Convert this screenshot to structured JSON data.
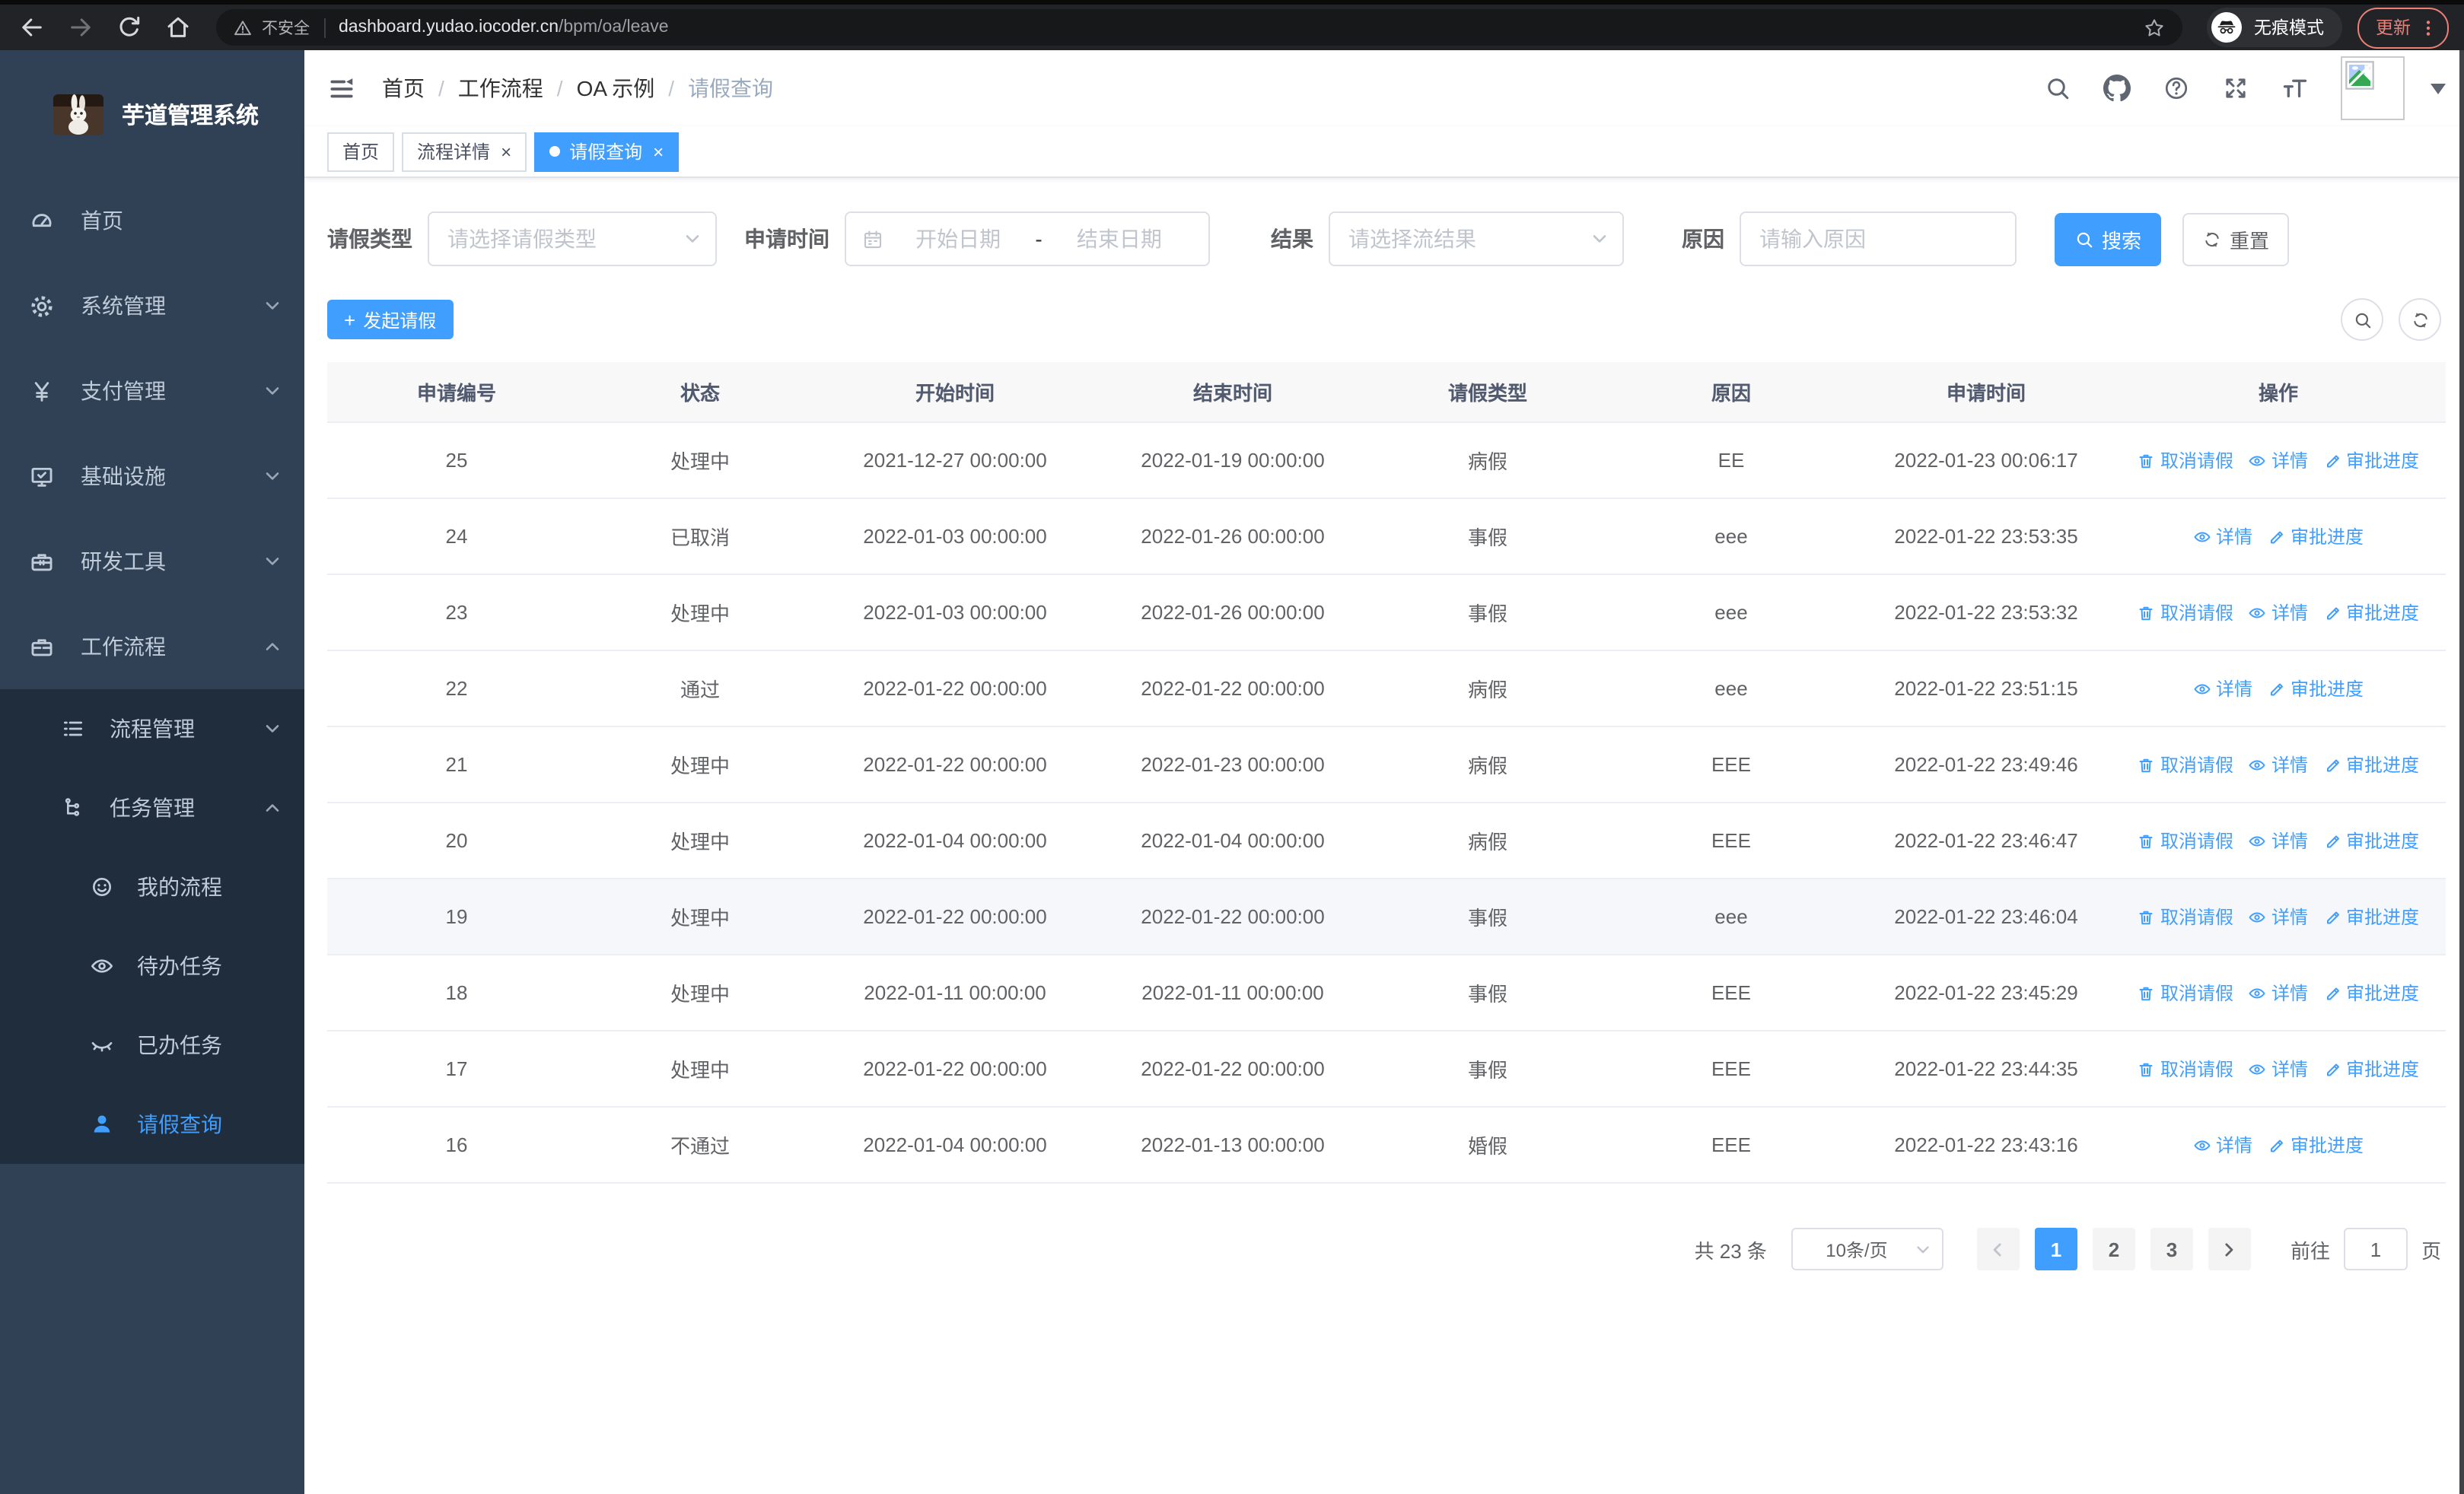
{
  "colors": {
    "primary": "#409eff",
    "sidebar_bg": "#304156",
    "sidebar_submenu_bg": "#1f2d3d",
    "table_header_bg": "#f8f8f9",
    "row_hover_bg": "#f5f7fa",
    "update_accent": "#ec8077"
  },
  "browser": {
    "security_label": "不安全",
    "url_host": "dashboard.yudao.iocoder.cn",
    "url_path": "/bpm/oa/leave",
    "incognito_label": "无痕模式",
    "update_label": "更新"
  },
  "sidebar": {
    "title": "芋道管理系统",
    "items": [
      {
        "key": "home",
        "icon": "gauge-icon",
        "label": "首页",
        "level": 1,
        "chevron": null,
        "active": false
      },
      {
        "key": "system-mgmt",
        "icon": "gear-icon",
        "label": "系统管理",
        "level": 1,
        "chevron": "down",
        "active": false
      },
      {
        "key": "payment-mgmt",
        "icon": "yen-icon",
        "label": "支付管理",
        "level": 1,
        "chevron": "down",
        "active": false
      },
      {
        "key": "infrastructure",
        "icon": "monitor-icon",
        "label": "基础设施",
        "level": 1,
        "chevron": "down",
        "active": false
      },
      {
        "key": "dev-tools",
        "icon": "toolbox-icon",
        "label": "研发工具",
        "level": 1,
        "chevron": "down",
        "active": false
      },
      {
        "key": "workflow",
        "icon": "briefcase-icon",
        "label": "工作流程",
        "level": 1,
        "chevron": "up",
        "active": false
      },
      {
        "key": "process-mgmt",
        "icon": "list-icon",
        "label": "流程管理",
        "level": 2,
        "chevron": "down",
        "active": false
      },
      {
        "key": "task-mgmt",
        "icon": "flow-icon",
        "label": "任务管理",
        "level": 2,
        "chevron": "up",
        "active": false
      },
      {
        "key": "my-process",
        "icon": "face-icon",
        "label": "我的流程",
        "level": 3,
        "chevron": null,
        "active": false
      },
      {
        "key": "todo-tasks",
        "icon": "eye-icon",
        "label": "待办任务",
        "level": 3,
        "chevron": null,
        "active": false
      },
      {
        "key": "done-tasks",
        "icon": "eye-closed-icon",
        "label": "已办任务",
        "level": 3,
        "chevron": null,
        "active": false
      },
      {
        "key": "leave-query",
        "icon": "user-icon",
        "label": "请假查询",
        "level": 3,
        "chevron": null,
        "active": true
      }
    ]
  },
  "header": {
    "breadcrumbs": [
      "首页",
      "工作流程",
      "OA 示例",
      "请假查询"
    ],
    "separator": "/"
  },
  "tabs": [
    {
      "key": "home",
      "label": "首页",
      "closable": false,
      "active": false
    },
    {
      "key": "process-detail",
      "label": "流程详情",
      "closable": true,
      "active": false
    },
    {
      "key": "leave-query",
      "label": "请假查询",
      "closable": true,
      "active": true
    }
  ],
  "filters": {
    "leave_type_label": "请假类型",
    "leave_type_placeholder": "请选择请假类型",
    "apply_time_label": "申请时间",
    "start_date_placeholder": "开始日期",
    "range_separator": "-",
    "end_date_placeholder": "结束日期",
    "result_label": "结果",
    "result_placeholder": "请选择流结果",
    "reason_label": "原因",
    "reason_placeholder": "请输入原因",
    "search_label": "搜索",
    "reset_label": "重置"
  },
  "toolbar": {
    "create_label": "发起请假"
  },
  "table": {
    "columns": [
      "申请编号",
      "状态",
      "开始时间",
      "结束时间",
      "请假类型",
      "原因",
      "申请时间",
      "操作"
    ],
    "action_labels": {
      "cancel": "取消请假",
      "detail": "详情",
      "progress": "审批进度"
    },
    "rows": [
      {
        "id": "25",
        "status": "处理中",
        "start": "2021-12-27 00:00:00",
        "end": "2022-01-19 00:00:00",
        "type": "病假",
        "reason": "EE",
        "apply": "2022-01-23 00:06:17",
        "actions": [
          "cancel",
          "detail",
          "progress"
        ],
        "hover": false
      },
      {
        "id": "24",
        "status": "已取消",
        "start": "2022-01-03 00:00:00",
        "end": "2022-01-26 00:00:00",
        "type": "事假",
        "reason": "eee",
        "apply": "2022-01-22 23:53:35",
        "actions": [
          "detail",
          "progress"
        ],
        "hover": false
      },
      {
        "id": "23",
        "status": "处理中",
        "start": "2022-01-03 00:00:00",
        "end": "2022-01-26 00:00:00",
        "type": "事假",
        "reason": "eee",
        "apply": "2022-01-22 23:53:32",
        "actions": [
          "cancel",
          "detail",
          "progress"
        ],
        "hover": false
      },
      {
        "id": "22",
        "status": "通过",
        "start": "2022-01-22 00:00:00",
        "end": "2022-01-22 00:00:00",
        "type": "病假",
        "reason": "eee",
        "apply": "2022-01-22 23:51:15",
        "actions": [
          "detail",
          "progress"
        ],
        "hover": false
      },
      {
        "id": "21",
        "status": "处理中",
        "start": "2022-01-22 00:00:00",
        "end": "2022-01-23 00:00:00",
        "type": "病假",
        "reason": "EEE",
        "apply": "2022-01-22 23:49:46",
        "actions": [
          "cancel",
          "detail",
          "progress"
        ],
        "hover": false
      },
      {
        "id": "20",
        "status": "处理中",
        "start": "2022-01-04 00:00:00",
        "end": "2022-01-04 00:00:00",
        "type": "病假",
        "reason": "EEE",
        "apply": "2022-01-22 23:46:47",
        "actions": [
          "cancel",
          "detail",
          "progress"
        ],
        "hover": false
      },
      {
        "id": "19",
        "status": "处理中",
        "start": "2022-01-22 00:00:00",
        "end": "2022-01-22 00:00:00",
        "type": "事假",
        "reason": "eee",
        "apply": "2022-01-22 23:46:04",
        "actions": [
          "cancel",
          "detail",
          "progress"
        ],
        "hover": true
      },
      {
        "id": "18",
        "status": "处理中",
        "start": "2022-01-11 00:00:00",
        "end": "2022-01-11 00:00:00",
        "type": "事假",
        "reason": "EEE",
        "apply": "2022-01-22 23:45:29",
        "actions": [
          "cancel",
          "detail",
          "progress"
        ],
        "hover": false
      },
      {
        "id": "17",
        "status": "处理中",
        "start": "2022-01-22 00:00:00",
        "end": "2022-01-22 00:00:00",
        "type": "事假",
        "reason": "EEE",
        "apply": "2022-01-22 23:44:35",
        "actions": [
          "cancel",
          "detail",
          "progress"
        ],
        "hover": false
      },
      {
        "id": "16",
        "status": "不通过",
        "start": "2022-01-04 00:00:00",
        "end": "2022-01-13 00:00:00",
        "type": "婚假",
        "reason": "EEE",
        "apply": "2022-01-22 23:43:16",
        "actions": [
          "detail",
          "progress"
        ],
        "hover": false
      }
    ]
  },
  "pagination": {
    "total_label": "共 23 条",
    "page_size_label": "10条/页",
    "pages": [
      "1",
      "2",
      "3"
    ],
    "active_page": "1",
    "goto_label": "前往",
    "goto_value": "1",
    "page_unit_label": "页"
  }
}
